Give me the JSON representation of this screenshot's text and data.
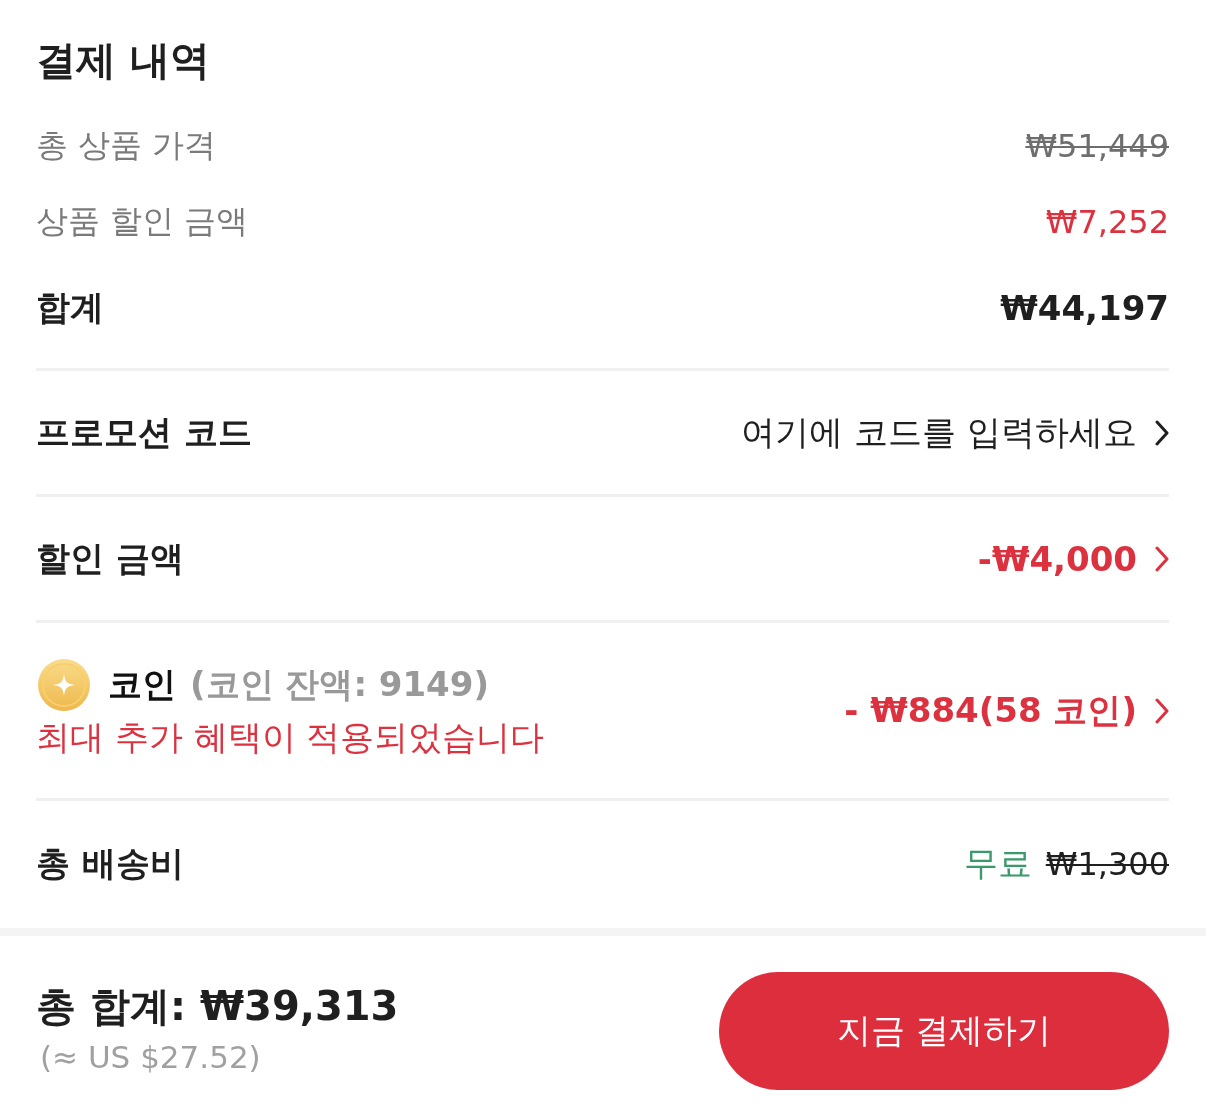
{
  "title": "결제 내역",
  "summary_rows": [
    {
      "kind": "original",
      "label": "총 상품 가격",
      "value": "₩51,449"
    },
    {
      "kind": "discount",
      "label": "상품 할인 금액",
      "value": "₩7,252"
    },
    {
      "kind": "total",
      "label": "합계",
      "value": "₩44,197"
    }
  ],
  "options": [
    {
      "kind": "promo",
      "label": "프로모션 코드",
      "value": "여기에 코드를 입력하세요"
    },
    {
      "kind": "discount",
      "label": "할인 금액",
      "value": "-₩4,000"
    },
    {
      "kind": "coins",
      "label": "코인",
      "balance": "(코인 잔액: 9149)",
      "note": "최대 추가 혜택이 적용되었습니다",
      "value": "- ₩884(58 코인)"
    },
    {
      "kind": "shipping",
      "label": "총 배송비",
      "value": "무료",
      "original": "₩1,300"
    }
  ],
  "footer": {
    "total_label": "총 합계:",
    "total_amount": "₩39,313",
    "converted": "(≈ US $27.52)",
    "button": "지금 결제하기"
  }
}
